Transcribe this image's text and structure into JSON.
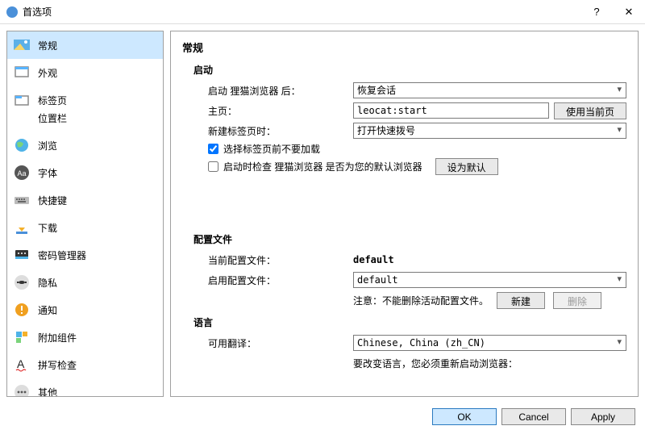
{
  "window": {
    "title": "首选项",
    "help": "?",
    "close": "✕"
  },
  "sidebar": {
    "items": [
      {
        "label": "常规"
      },
      {
        "label": "外观"
      },
      {
        "label": "标签页"
      },
      {
        "label": "位置栏"
      },
      {
        "label": "浏览"
      },
      {
        "label": "字体"
      },
      {
        "label": "快捷键"
      },
      {
        "label": "下载"
      },
      {
        "label": "密码管理器"
      },
      {
        "label": "隐私"
      },
      {
        "label": "通知"
      },
      {
        "label": "附加组件"
      },
      {
        "label": "拼写检查"
      },
      {
        "label": "其他"
      }
    ]
  },
  "content": {
    "heading": "常规",
    "startup": {
      "title": "启动",
      "on_start_label": "启动 狸猫浏览器 后：",
      "on_start_value": "恢复会话",
      "homepage_label": "主页：",
      "homepage_value": "leocat:start",
      "use_current_btn": "使用当前页",
      "new_tab_label": "新建标签页时：",
      "new_tab_value": "打开快速拨号",
      "checkbox_noload": "选择标签页前不要加载",
      "checkbox_default": "启动时检查 狸猫浏览器 是否为您的默认浏览器",
      "set_default_btn": "设为默认"
    },
    "profiles": {
      "title": "配置文件",
      "current_label": "当前配置文件：",
      "current_value": "default",
      "enable_label": "启用配置文件：",
      "enable_value": "default",
      "note": "注意：不能删除活动配置文件。",
      "new_btn": "新建",
      "delete_btn": "删除"
    },
    "language": {
      "title": "语言",
      "available_label": "可用翻译：",
      "available_value": "Chinese, China (zh_CN)",
      "restart_note": "要改变语言，您必须重新启动浏览器："
    }
  },
  "footer": {
    "ok": "OK",
    "cancel": "Cancel",
    "apply": "Apply"
  }
}
